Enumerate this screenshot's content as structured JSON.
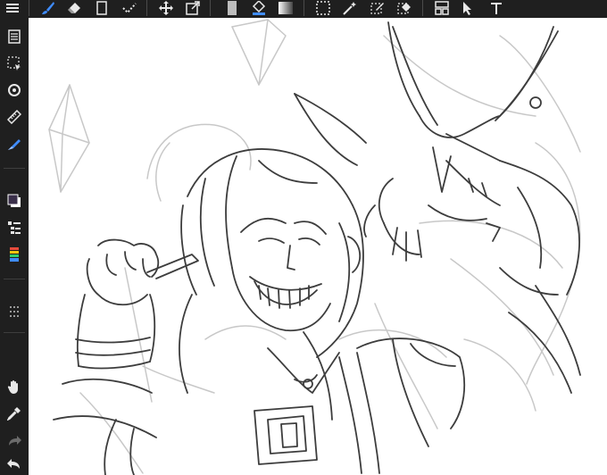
{
  "app": {
    "accent": "#3f8cff",
    "chrome": "#1f1f1f"
  },
  "toolbar": {
    "tools": [
      {
        "name": "menu-icon",
        "interactive": true
      },
      {
        "name": "brush-icon",
        "interactive": true,
        "selected": true
      },
      {
        "name": "eraser-icon",
        "interactive": true
      },
      {
        "name": "smudge-icon",
        "interactive": true
      },
      {
        "name": "blend-icon",
        "interactive": true
      },
      {
        "name": "move-icon",
        "interactive": true
      },
      {
        "name": "transform-icon",
        "interactive": true
      },
      {
        "name": "fill-icon",
        "interactive": true
      },
      {
        "name": "paint-bucket-icon",
        "interactive": true
      },
      {
        "name": "gradient-icon",
        "interactive": true
      },
      {
        "name": "marquee-icon",
        "interactive": true
      },
      {
        "name": "magic-wand-icon",
        "interactive": true
      },
      {
        "name": "selection-pen-icon",
        "interactive": true
      },
      {
        "name": "selection-eraser-icon",
        "interactive": true
      },
      {
        "name": "frame-divider-icon",
        "interactive": true
      },
      {
        "name": "edit-frame-icon",
        "interactive": true
      },
      {
        "name": "text-icon",
        "interactive": true
      }
    ]
  },
  "sidebar": {
    "items": [
      {
        "name": "pages-icon"
      },
      {
        "name": "selection-icon"
      },
      {
        "name": "rotate-icon"
      },
      {
        "name": "ruler-icon"
      },
      {
        "name": "snap-icon"
      },
      {
        "name": "color-swatch-icon"
      },
      {
        "name": "layers-icon"
      },
      {
        "name": "color-set-icon"
      },
      {
        "name": "grip-icon"
      },
      {
        "name": "hand-icon"
      },
      {
        "name": "eyedropper-icon"
      },
      {
        "name": "redo-icon"
      },
      {
        "name": "undo-icon"
      }
    ]
  }
}
